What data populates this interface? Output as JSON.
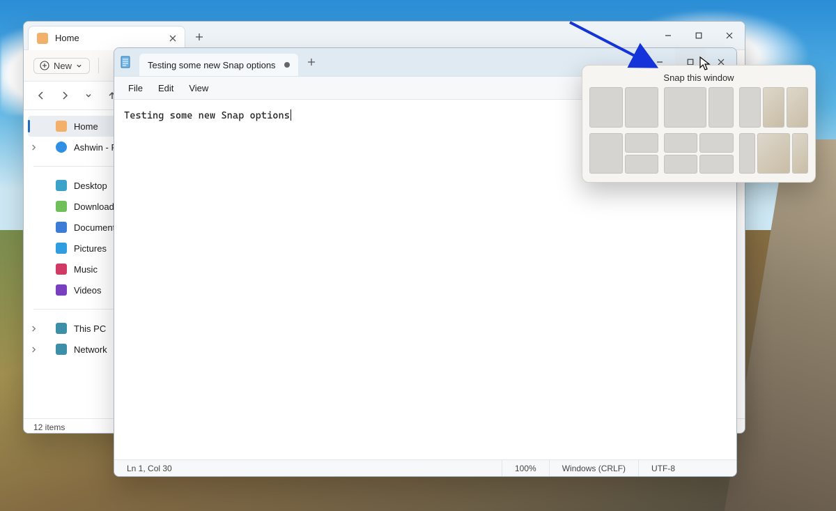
{
  "explorer": {
    "tab_title": "Home",
    "new_label": "New",
    "sidebar": {
      "home": "Home",
      "user": "Ashwin - Person",
      "desktop": "Desktop",
      "downloads": "Downloads",
      "documents": "Documents",
      "pictures": "Pictures",
      "music": "Music",
      "videos": "Videos",
      "thispc": "This PC",
      "network": "Network"
    },
    "status": "12 items"
  },
  "notepad": {
    "tab_title": "Testing some new Snap options",
    "menu": {
      "file": "File",
      "edit": "Edit",
      "view": "View"
    },
    "content": "Testing some new Snap options",
    "status": {
      "pos": "Ln 1, Col 30",
      "zoom": "100%",
      "eol": "Windows (CRLF)",
      "enc": "UTF-8"
    }
  },
  "snap": {
    "title": "Snap this window"
  }
}
